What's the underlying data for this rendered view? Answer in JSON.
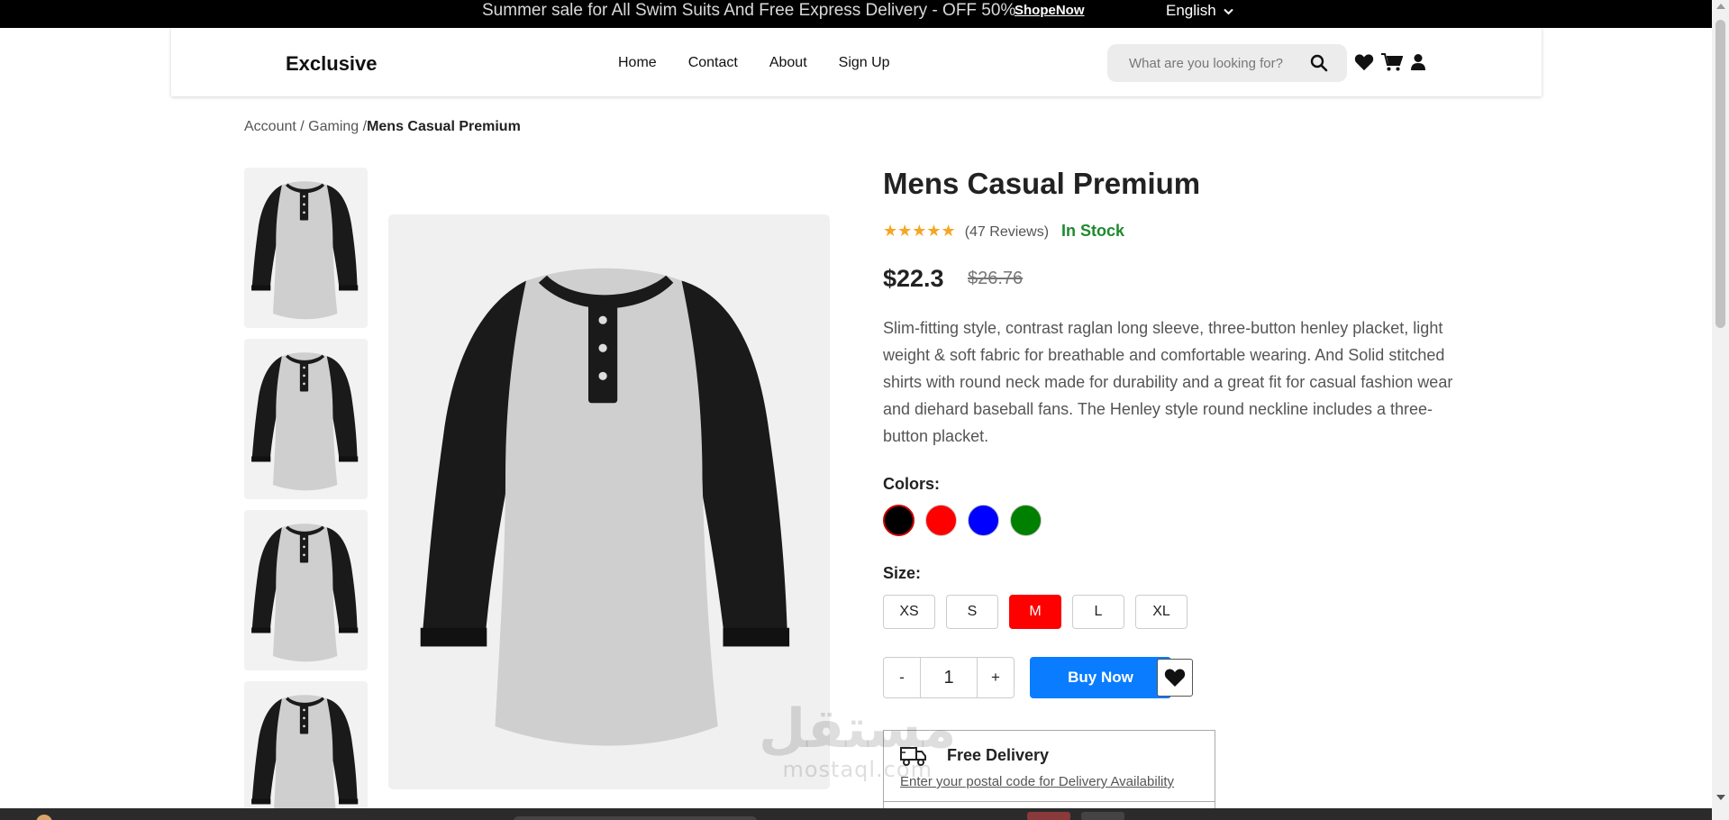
{
  "topbar": {
    "message": "Summer sale for All Swim Suits And Free Express Delivery - OFF 50%",
    "shop_link": "ShopeNow",
    "language": "English"
  },
  "header": {
    "logo": "Exclusive",
    "nav": [
      "Home",
      "Contact",
      "About",
      "Sign Up"
    ],
    "search_placeholder": "What are you looking for?",
    "icons": [
      "heart-icon",
      "cart-icon",
      "user-icon"
    ]
  },
  "breadcrumb": {
    "items": [
      "Account",
      "Gaming"
    ],
    "separator": " / ",
    "current": "Mens Casual Premium"
  },
  "product": {
    "title": "Mens Casual Premium",
    "stars": "★★★★★",
    "rating": 5,
    "reviews": "(47 Reviews)",
    "stock": "In Stock",
    "price": "$22.3",
    "old_price": "$26.76",
    "description": "Slim-fitting style, contrast raglan long sleeve, three-button henley placket, light weight & soft fabric for breathable and comfortable wearing. And Solid stitched shirts with round neck made for durability and a great fit for casual fashion wear and diehard baseball fans. The Henley style round neckline includes a three-button placket.",
    "colors_label": "Colors:",
    "colors": [
      {
        "name": "black",
        "hex": "#000000",
        "selected": true
      },
      {
        "name": "red",
        "hex": "#ff0000",
        "selected": false
      },
      {
        "name": "blue",
        "hex": "#0000ff",
        "selected": false
      },
      {
        "name": "green",
        "hex": "#008000",
        "selected": false
      }
    ],
    "size_label": "Size:",
    "sizes": [
      "XS",
      "S",
      "M",
      "L",
      "XL"
    ],
    "selected_size": "M",
    "quantity": {
      "minus": "-",
      "value": "1",
      "plus": "+"
    },
    "buy_label": "Buy Now",
    "thumbnail_count": 4
  },
  "delivery": {
    "title": "Free Delivery",
    "link": "Enter your postal code for Delivery Availability"
  },
  "watermark": {
    "arabic": "مستقل",
    "latin": "mostaql.com"
  },
  "colors": {
    "accent_red": "#ff0000",
    "buy_blue": "#0a7cff",
    "stock_green": "#1e8a2e",
    "star_gold": "#f5a623"
  }
}
